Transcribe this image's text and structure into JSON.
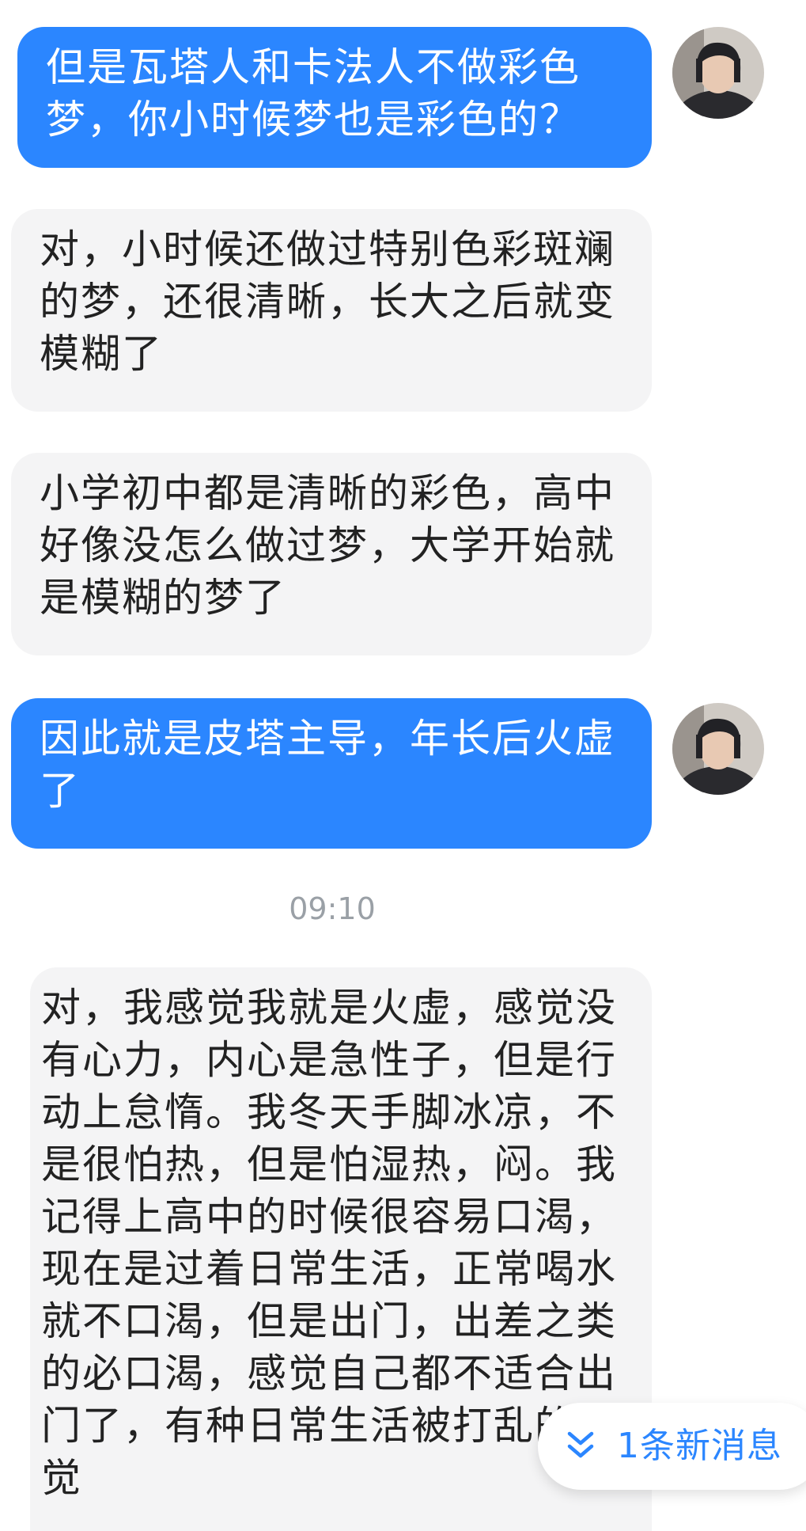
{
  "messages": [
    {
      "side": "right",
      "text": "但是瓦塔人和卡法人不做彩色\n梦，你小时候梦也是彩色的？"
    },
    {
      "side": "left",
      "text": "对，小时候还做过特别色彩斑斓\n的梦，还很清晰，长大之后就变\n模糊了"
    },
    {
      "side": "left",
      "text": "小学初中都是清晰的彩色，高中\n好像没怎么做过梦，大学开始就\n是模糊的梦了"
    },
    {
      "side": "right",
      "text": "因此就是皮塔主导，年长后火虚\n了"
    },
    {
      "side": "left",
      "text": "对，我感觉我就是火虚，感觉没\n有心力，内心是急性子，但是行\n动上怠惰。我冬天手脚冰凉，不\n是很怕热，但是怕湿热，闷。我\n记得上高中的时候很容易口渴，\n现在是过着日常生活，正常喝水\n就不口渴，但是出门，出差之类\n的必口渴，感觉自己都不适合出\n门了，有种日常生活被打乱的感\n觉"
    }
  ],
  "timestamp": "09:10",
  "new_messages_label": "1条新消息",
  "icons": {
    "new_messages": "chevron-double-down-icon",
    "avatar": "user-avatar"
  },
  "colors": {
    "accent": "#2b86ff",
    "bubble_other": "#f4f4f5",
    "timestamp": "#9aa0a6"
  }
}
